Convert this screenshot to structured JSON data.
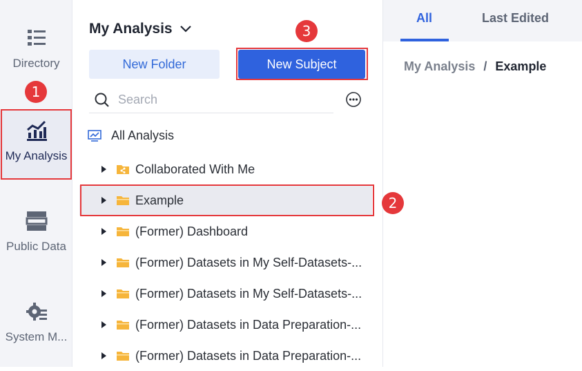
{
  "rail": {
    "items": [
      {
        "label": "Directory",
        "icon": "list-icon"
      },
      {
        "label": "My Analysis",
        "icon": "analysis-chart-icon"
      },
      {
        "label": "Public Data",
        "icon": "database-icon"
      },
      {
        "label": "System M...",
        "icon": "gear-list-icon"
      }
    ]
  },
  "panel": {
    "title": "My Analysis",
    "new_folder": "New Folder",
    "new_subject": "New Subject",
    "search_placeholder": "Search",
    "root": "All Analysis",
    "tree": [
      "Collaborated With Me",
      "Example",
      "(Former) Dashboard",
      "(Former) Datasets in My Self-Datasets-...",
      "(Former) Datasets in My Self-Datasets-...",
      "(Former) Datasets in Data Preparation-...",
      "(Former) Datasets in Data Preparation-..."
    ]
  },
  "right": {
    "tabs": [
      "All",
      "Last Edited"
    ],
    "breadcrumb": [
      "My Analysis",
      "/",
      "Example"
    ]
  },
  "annotations": [
    "1",
    "2",
    "3"
  ],
  "colors": {
    "accent": "#2f62de",
    "highlight": "#e5383b",
    "folder": "#f6b53b"
  }
}
